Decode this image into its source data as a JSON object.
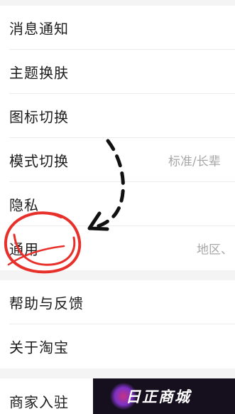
{
  "settings": {
    "items": [
      {
        "label": "消息通知",
        "value": ""
      },
      {
        "label": "主题换肤",
        "value": ""
      },
      {
        "label": "图标切换",
        "value": ""
      },
      {
        "label": "模式切换",
        "value": "标准/长辈"
      },
      {
        "label": "隐私",
        "value": ""
      },
      {
        "label": "通用",
        "value": "地区、"
      },
      {
        "label": "帮助与反馈",
        "value": ""
      },
      {
        "label": "关于淘宝",
        "value": ""
      },
      {
        "label": "商家入驻",
        "value": ""
      }
    ]
  },
  "annotation": {
    "circle_color": "#e8302a",
    "arrow_color": "#111111"
  },
  "watermark": {
    "text": "日正商城"
  }
}
